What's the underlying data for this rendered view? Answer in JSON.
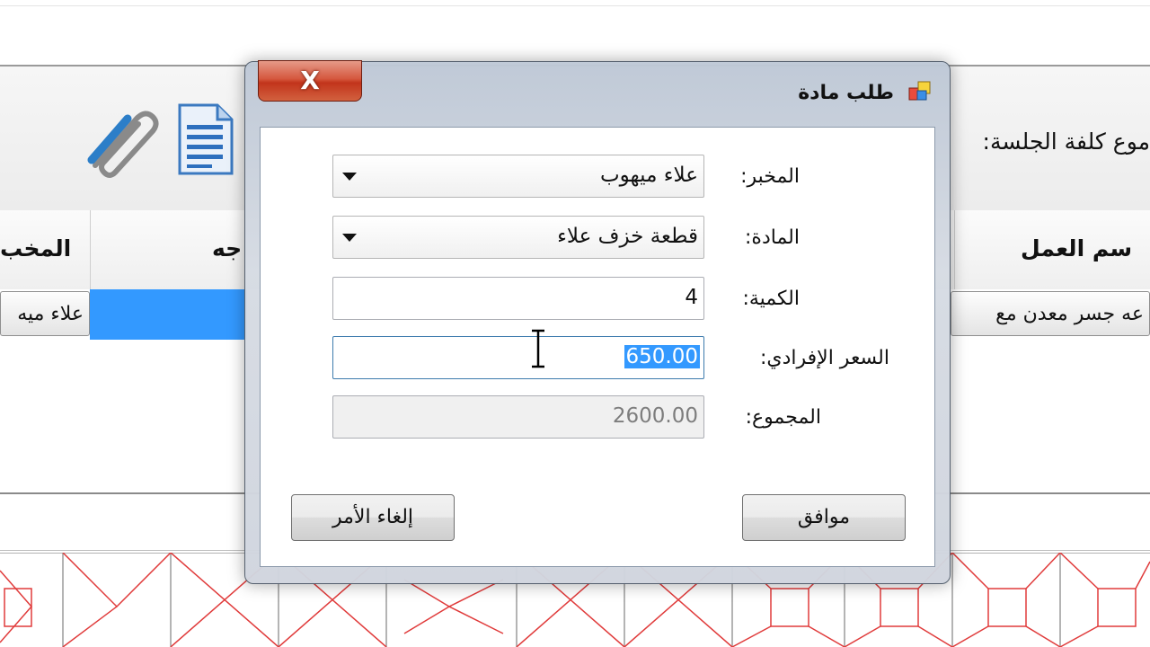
{
  "background": {
    "session_cost_label": "موع كلفة الجلسة:",
    "grid_columns": [
      {
        "name": "col-work-name",
        "label": "سم العمل"
      },
      {
        "name": "col-direction",
        "label": "جه"
      },
      {
        "name": "col-lab",
        "label": "المخب"
      }
    ],
    "grid_row": {
      "work_name": "عه جسر معدن مع",
      "lab": "علاء ميه"
    },
    "icons": [
      "paperclip-icon",
      "document-icon"
    ]
  },
  "dialog": {
    "title": "طلب مادة",
    "icon": "window-app-icon",
    "close_label": "X",
    "fields": {
      "lab": {
        "label": "المخبر:",
        "value": "علاء ميهوب"
      },
      "material": {
        "label": "المادة:",
        "value": "قطعة خزف علاء"
      },
      "quantity": {
        "label": "الكمية:",
        "value": "4"
      },
      "unit_price": {
        "label": "السعر الإفرادي:",
        "value": "650.00"
      },
      "total": {
        "label": "المجموع:",
        "value": "2600.00"
      }
    },
    "buttons": {
      "ok": "موافق",
      "cancel": "إلغاء الأمر"
    }
  },
  "colors": {
    "selection": "#3399ff",
    "close_button": "#c8391f",
    "pattern_lines": "#e03b3b"
  }
}
